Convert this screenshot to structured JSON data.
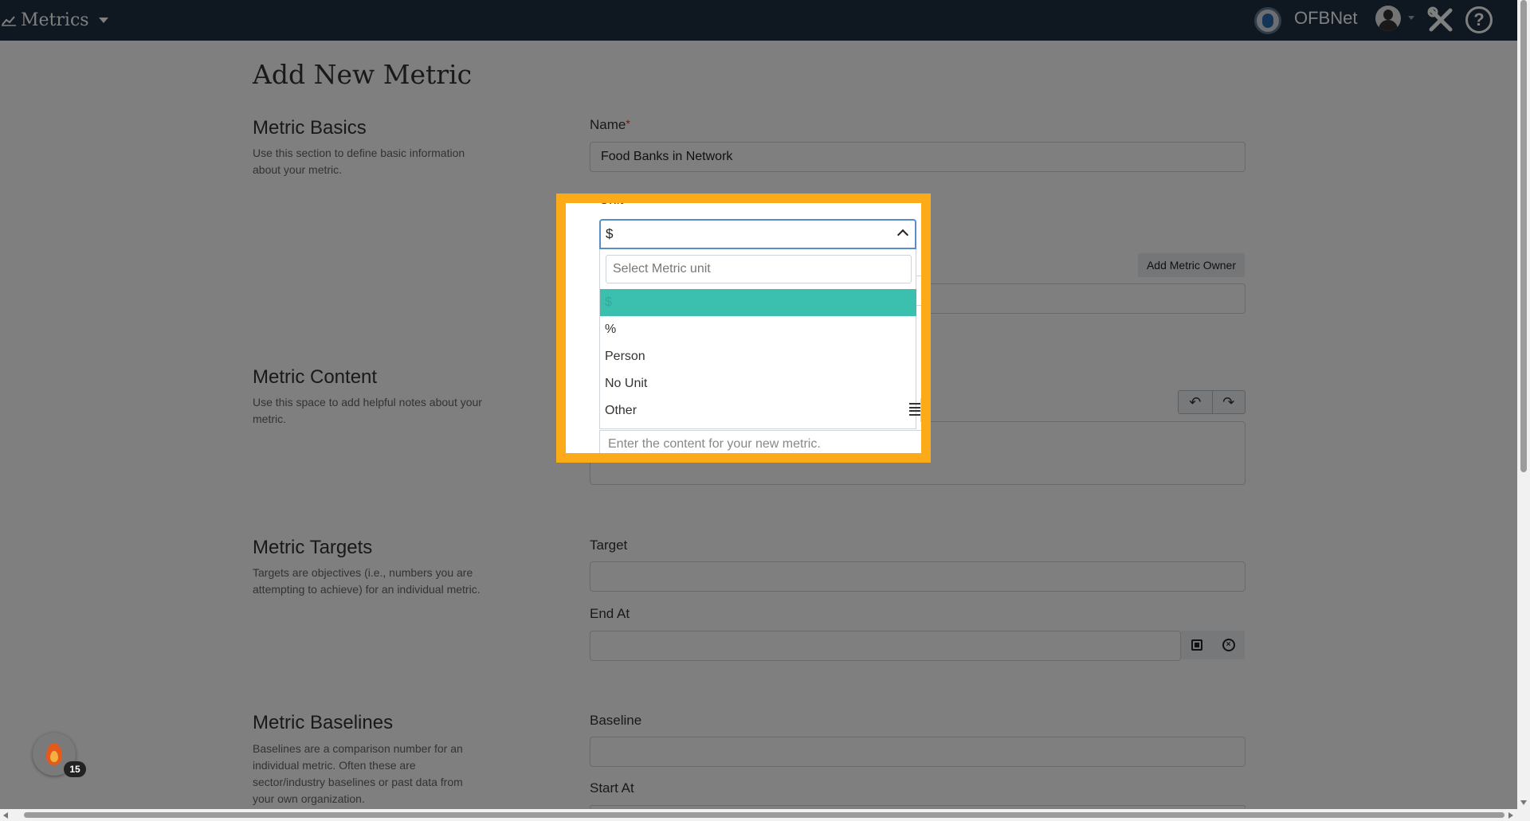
{
  "topbar": {
    "app_label": "Metrics",
    "org_name": "OFBNet"
  },
  "page": {
    "title": "Add New Metric"
  },
  "sections": {
    "basics": {
      "title": "Metric Basics",
      "desc": "Use this section to define basic information about your metric."
    },
    "content": {
      "title": "Metric Content",
      "desc": "Use this space to add helpful notes about your metric."
    },
    "targets": {
      "title": "Metric Targets",
      "desc": "Targets are objectives (i.e., numbers you are attempting to achieve) for an individual metric."
    },
    "baselines": {
      "title": "Metric Baselines",
      "desc": "Baselines are a comparison number for an individual metric. Often these are sector/industry baselines or past data from your own organization."
    }
  },
  "form": {
    "name_label": "Name",
    "name_value": "Food Banks in Network",
    "unit_label": "Unit",
    "required_mark": "*",
    "add_owner_button": "Add Metric Owner",
    "target_label": "Target",
    "end_at_label": "End At",
    "baseline_label": "Baseline",
    "start_at_label": "Start At"
  },
  "unit_dropdown": {
    "selected_value": "$",
    "search_placeholder": "Select Metric unit",
    "options": [
      "$",
      "%",
      "Person",
      "No Unit",
      "Other"
    ]
  },
  "content_editor": {
    "placeholder": "Enter the content for your new metric."
  },
  "notification_badge": {
    "count": "15"
  },
  "colors": {
    "topbar": "#1f3042",
    "highlight_border": "#fbab18",
    "selected_option": "#3bbfaf"
  }
}
